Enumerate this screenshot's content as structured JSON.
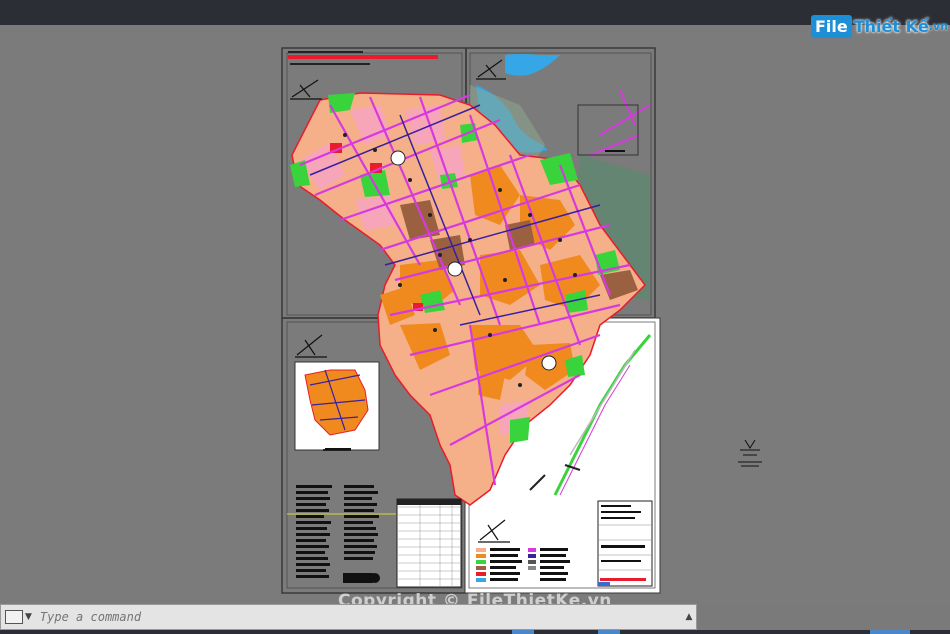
{
  "logo": {
    "box": "File",
    "rest": "Thiết Kế",
    "suffix": ".vn"
  },
  "watermark": "Copyright © FileThietKe.vn",
  "command": {
    "placeholder": "Type a command"
  },
  "icons": {
    "compass": "north-arrow-icon",
    "command": "command-line-icon"
  },
  "colors": {
    "background": "#7b7b7b",
    "topbar": "#2b2e35",
    "residential": "#f5b089",
    "road": "#d63adf",
    "green": "#39d43c",
    "orange": "#f08a1e",
    "water": "#35a6e6",
    "red": "#e81c2c"
  }
}
